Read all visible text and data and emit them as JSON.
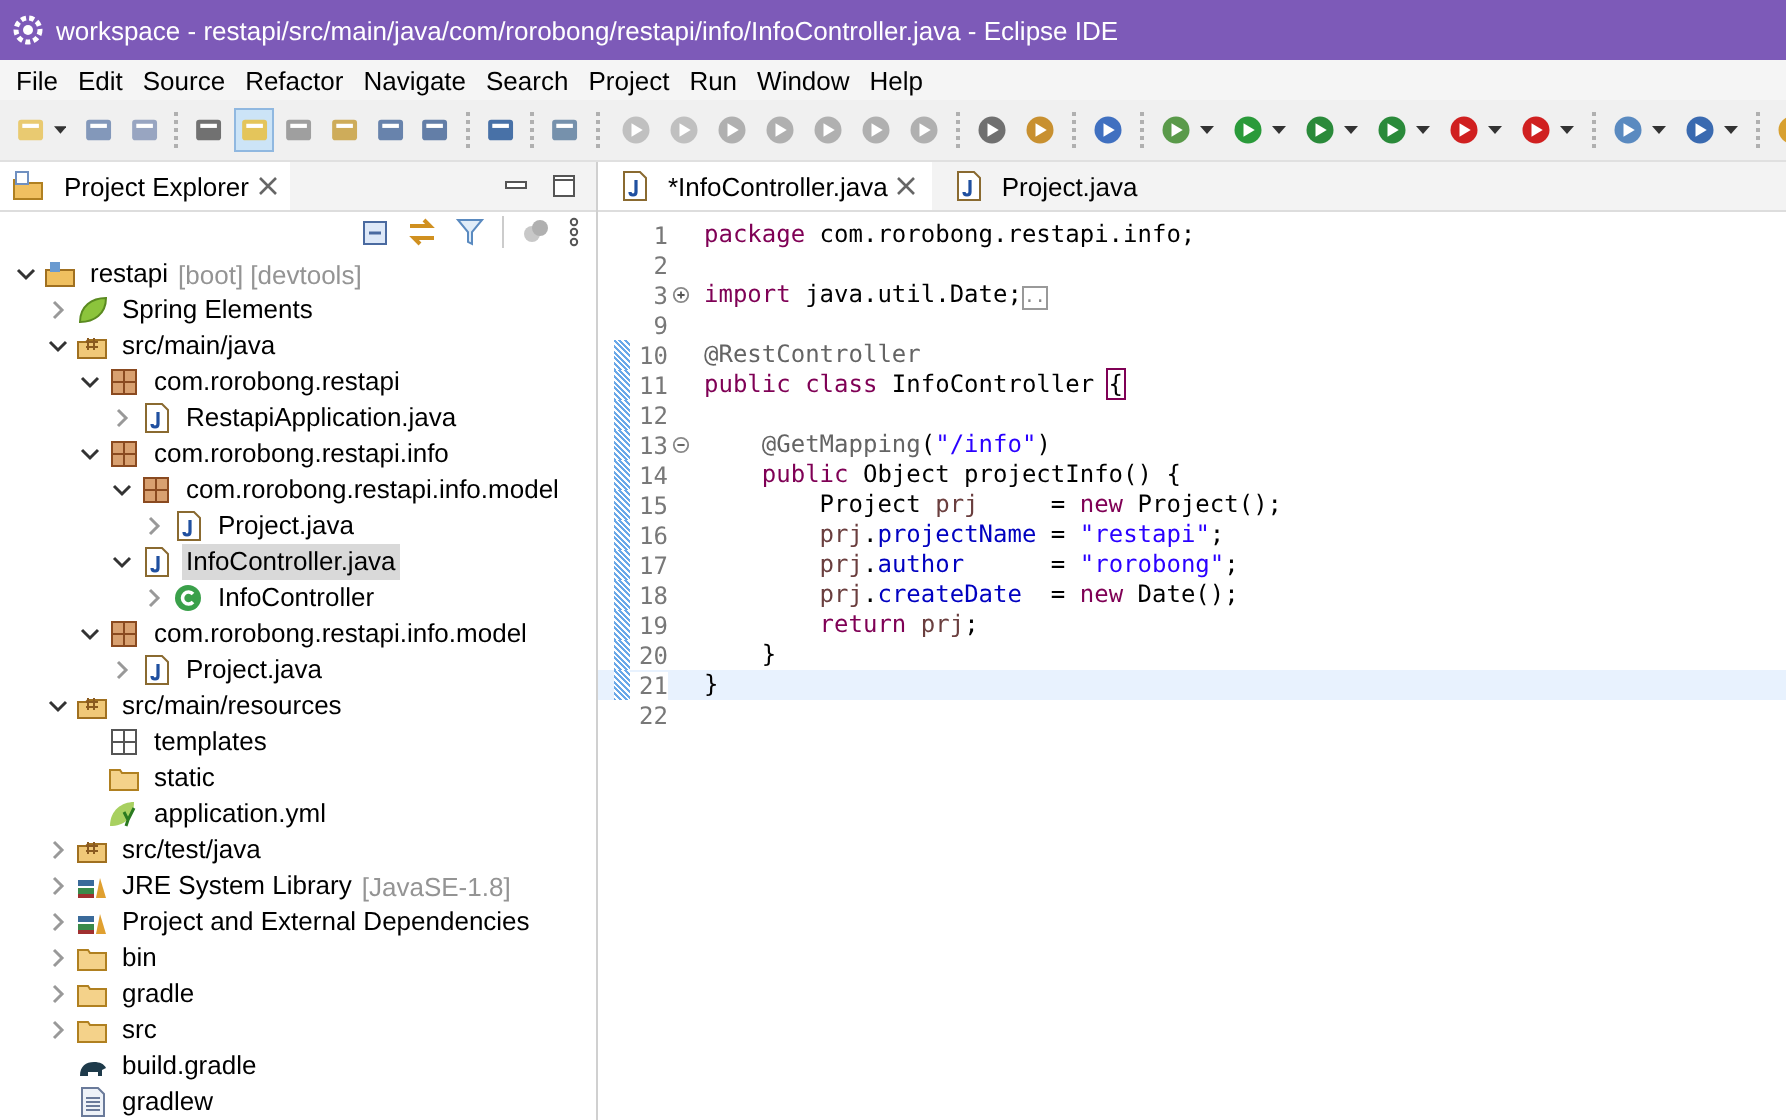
{
  "window": {
    "title": "workspace - restapi/src/main/java/com/rorobong/restapi/info/InfoController.java - Eclipse IDE"
  },
  "menu": [
    "File",
    "Edit",
    "Source",
    "Refactor",
    "Navigate",
    "Search",
    "Project",
    "Run",
    "Window",
    "Help"
  ],
  "explorer": {
    "title": "Project Explorer",
    "tree": [
      {
        "label": "restapi",
        "decoration": "[boot] [devtools]",
        "kind": "project",
        "expanded": true,
        "selected": false,
        "children": [
          {
            "label": "Spring Elements",
            "kind": "spring",
            "expanded": false,
            "selected": false
          },
          {
            "label": "src/main/java",
            "kind": "source",
            "expanded": true,
            "selected": false,
            "children": [
              {
                "label": "com.rorobong.restapi",
                "kind": "package",
                "expanded": true,
                "selected": false,
                "children": [
                  {
                    "label": "RestapiApplication.java",
                    "kind": "java",
                    "expanded": false,
                    "selected": false
                  }
                ]
              },
              {
                "label": "com.rorobong.restapi.info",
                "kind": "package",
                "expanded": true,
                "selected": false,
                "children": [
                  {
                    "label": "com.rorobong.restapi.info.model",
                    "kind": "package",
                    "expanded": true,
                    "selected": false,
                    "children": [
                      {
                        "label": "Project.java",
                        "kind": "java",
                        "expanded": false,
                        "selected": false
                      }
                    ]
                  },
                  {
                    "label": "InfoController.java",
                    "kind": "java",
                    "expanded": true,
                    "selected": true,
                    "children": [
                      {
                        "label": "InfoController",
                        "kind": "class",
                        "expanded": false,
                        "selected": false
                      }
                    ]
                  }
                ]
              },
              {
                "label": "com.rorobong.restapi.info.model",
                "kind": "package",
                "expanded": true,
                "selected": false,
                "children": [
                  {
                    "label": "Project.java",
                    "kind": "java",
                    "expanded": false,
                    "selected": false
                  }
                ]
              }
            ]
          },
          {
            "label": "src/main/resources",
            "kind": "source",
            "expanded": true,
            "selected": false,
            "children": [
              {
                "label": "templates",
                "kind": "grid",
                "selected": false
              },
              {
                "label": "static",
                "kind": "folder",
                "selected": false
              },
              {
                "label": "application.yml",
                "kind": "yaml",
                "selected": false
              }
            ]
          },
          {
            "label": "src/test/java",
            "kind": "source",
            "expanded": false,
            "selected": false
          },
          {
            "label": "JRE System Library",
            "decoration": "[JavaSE-1.8]",
            "kind": "library",
            "expanded": false,
            "selected": false
          },
          {
            "label": "Project and External Dependencies",
            "kind": "library",
            "expanded": false,
            "selected": false
          },
          {
            "label": "bin",
            "kind": "folder",
            "expanded": false,
            "selected": false
          },
          {
            "label": "gradle",
            "kind": "folder",
            "expanded": false,
            "selected": false
          },
          {
            "label": "src",
            "kind": "folder",
            "expanded": false,
            "selected": false
          },
          {
            "label": "build.gradle",
            "kind": "gradle",
            "selected": false
          },
          {
            "label": "gradlew",
            "kind": "text",
            "selected": false
          }
        ]
      }
    ]
  },
  "editor": {
    "tabs": [
      {
        "label": "*InfoController.java",
        "selected": true
      },
      {
        "label": "Project.java",
        "selected": false
      }
    ],
    "lines": [
      {
        "number": "1",
        "changed": false,
        "current": false,
        "tokens": [
          {
            "kind": "keyword",
            "text": "package"
          },
          {
            "kind": "plain",
            "text": " com.rorobong.restapi.info;"
          }
        ]
      },
      {
        "number": "2",
        "changed": false,
        "current": false
      },
      {
        "number": "3",
        "collapsed": true,
        "changed": false,
        "current": false,
        "tokens": [
          {
            "kind": "keyword",
            "text": "import"
          },
          {
            "kind": "plain",
            "text": " java.util.Date;"
          },
          {
            "kind": "folded",
            "text": ".."
          }
        ]
      },
      {
        "number": "9",
        "changed": false,
        "current": false
      },
      {
        "number": "10",
        "changed": true,
        "current": false,
        "tokens": [
          {
            "kind": "annotation",
            "text": "@RestController"
          }
        ]
      },
      {
        "number": "11",
        "changed": true,
        "current": false,
        "tokens": [
          {
            "kind": "keyword",
            "text": "public class"
          },
          {
            "kind": "plain",
            "text": " InfoController "
          },
          {
            "kind": "bracket",
            "text": "{"
          }
        ]
      },
      {
        "number": "12",
        "changed": true,
        "current": false
      },
      {
        "number": "13",
        "collapsed": false,
        "changed": true,
        "current": false,
        "tokens": [
          {
            "kind": "annotation",
            "text": "    @GetMapping"
          },
          {
            "kind": "plain",
            "text": "("
          },
          {
            "kind": "string",
            "text": "\"/info\""
          },
          {
            "kind": "plain",
            "text": ")"
          }
        ]
      },
      {
        "number": "14",
        "changed": true,
        "current": false,
        "tokens": [
          {
            "kind": "keyword",
            "text": "    public"
          },
          {
            "kind": "plain",
            "text": " Object projectInfo() {"
          }
        ]
      },
      {
        "number": "15",
        "changed": true,
        "current": false,
        "tokens": [
          {
            "kind": "plain",
            "text": "        Project "
          },
          {
            "kind": "local",
            "text": "prj"
          },
          {
            "kind": "plain",
            "text": "     = "
          },
          {
            "kind": "keyword",
            "text": "new"
          },
          {
            "kind": "plain",
            "text": " Project();"
          }
        ]
      },
      {
        "number": "16",
        "changed": true,
        "current": false,
        "tokens": [
          {
            "kind": "local",
            "text": "        prj"
          },
          {
            "kind": "plain",
            "text": "."
          },
          {
            "kind": "field",
            "text": "projectName"
          },
          {
            "kind": "plain",
            "text": " = "
          },
          {
            "kind": "string",
            "text": "\"restapi\""
          },
          {
            "kind": "plain",
            "text": ";"
          }
        ]
      },
      {
        "number": "17",
        "changed": true,
        "current": false,
        "tokens": [
          {
            "kind": "local",
            "text": "        prj"
          },
          {
            "kind": "plain",
            "text": "."
          },
          {
            "kind": "field",
            "text": "author"
          },
          {
            "kind": "plain",
            "text": "      = "
          },
          {
            "kind": "string",
            "text": "\"rorobong\""
          },
          {
            "kind": "plain",
            "text": ";"
          }
        ]
      },
      {
        "number": "18",
        "changed": true,
        "current": false,
        "tokens": [
          {
            "kind": "local",
            "text": "        prj"
          },
          {
            "kind": "plain",
            "text": "."
          },
          {
            "kind": "field",
            "text": "createDate"
          },
          {
            "kind": "plain",
            "text": "  = "
          },
          {
            "kind": "keyword",
            "text": "new"
          },
          {
            "kind": "plain",
            "text": " Date();"
          }
        ]
      },
      {
        "number": "19",
        "changed": true,
        "current": false,
        "tokens": [
          {
            "kind": "keyword",
            "text": "        return "
          },
          {
            "kind": "local",
            "text": "prj"
          },
          {
            "kind": "plain",
            "text": ";"
          }
        ]
      },
      {
        "number": "20",
        "changed": true,
        "current": false,
        "tokens": [
          {
            "kind": "plain",
            "text": "    }"
          }
        ]
      },
      {
        "number": "21",
        "changed": true,
        "current": true,
        "tokens": [
          {
            "kind": "plain",
            "text": "}"
          }
        ]
      },
      {
        "number": "22",
        "changed": false,
        "current": false
      }
    ]
  }
}
